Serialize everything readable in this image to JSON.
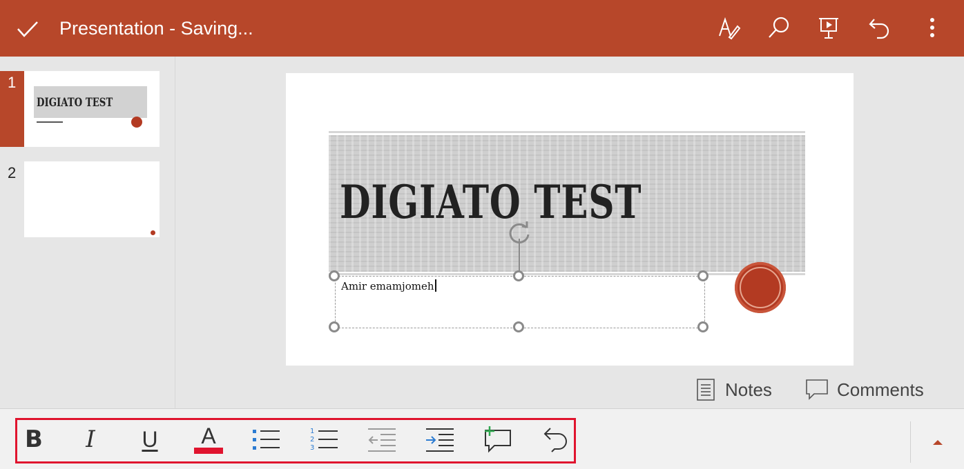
{
  "header": {
    "title": "Presentation - Saving...",
    "icons": [
      "checkmark-icon",
      "draw-pen-icon",
      "search-icon",
      "present-icon",
      "undo-icon",
      "more-vertical-icon"
    ]
  },
  "sidebar": {
    "slides": [
      {
        "number": "1",
        "thumb_title": "DIGIATO TEST",
        "active": true
      },
      {
        "number": "2",
        "active": false
      }
    ],
    "add_icon": "add-slide-icon"
  },
  "slide": {
    "title": "DIGIATO TEST",
    "subtitle": "Amir emamjomeh"
  },
  "bottom_links": {
    "notes": "Notes",
    "comments": "Comments"
  },
  "format_toolbar": {
    "bold": "B",
    "italic": "I",
    "underline": "U",
    "font_color_letter": "A",
    "font_color": "#e0142e",
    "icons": [
      "bullets-icon",
      "numbering-icon",
      "decrease-indent-icon",
      "increase-indent-icon",
      "new-comment-icon",
      "undo-icon",
      "collapse-up-icon"
    ]
  },
  "colors": {
    "accent": "#b7472a",
    "highlight_frame": "#e0142e"
  }
}
